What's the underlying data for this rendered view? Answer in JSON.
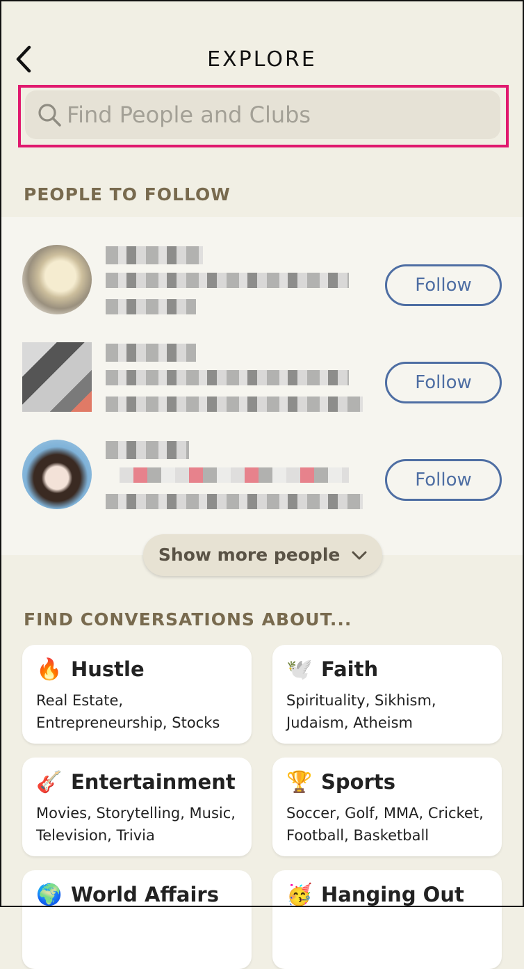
{
  "header": {
    "title": "EXPLORE"
  },
  "search": {
    "placeholder": "Find People and Clubs"
  },
  "people_section": {
    "title": "PEOPLE TO FOLLOW"
  },
  "people": [
    {
      "follow_label": "Follow"
    },
    {
      "follow_label": "Follow"
    },
    {
      "follow_label": "Follow"
    }
  ],
  "show_more": {
    "label": "Show more people"
  },
  "topics_section": {
    "title": "FIND CONVERSATIONS ABOUT..."
  },
  "topics": [
    {
      "emoji": "🔥",
      "icon": "fire-icon",
      "title": "Hustle",
      "subtitle": "Real Estate, Entrepreneurship, Stocks"
    },
    {
      "emoji": "🕊️",
      "icon": "dove-icon",
      "title": "Faith",
      "subtitle": "Spirituality, Sikhism, Judaism, Atheism"
    },
    {
      "emoji": "🎸",
      "icon": "guitar-icon",
      "title": "Entertainment",
      "subtitle": "Movies, Storytelling, Music, Television, Trivia"
    },
    {
      "emoji": "🏆",
      "icon": "trophy-icon",
      "title": "Sports",
      "subtitle": "Soccer, Golf, MMA, Cricket, Football, Basketball"
    },
    {
      "emoji": "🌍",
      "icon": "globe-icon",
      "title": "World Affairs",
      "subtitle": ""
    },
    {
      "emoji": "🥳",
      "icon": "party-face-icon",
      "title": "Hanging Out",
      "subtitle": ""
    }
  ],
  "colors": {
    "accent": "#4e6ea3",
    "highlight": "#e0196e",
    "section_title": "#786a4e",
    "background": "#f1efe4"
  }
}
